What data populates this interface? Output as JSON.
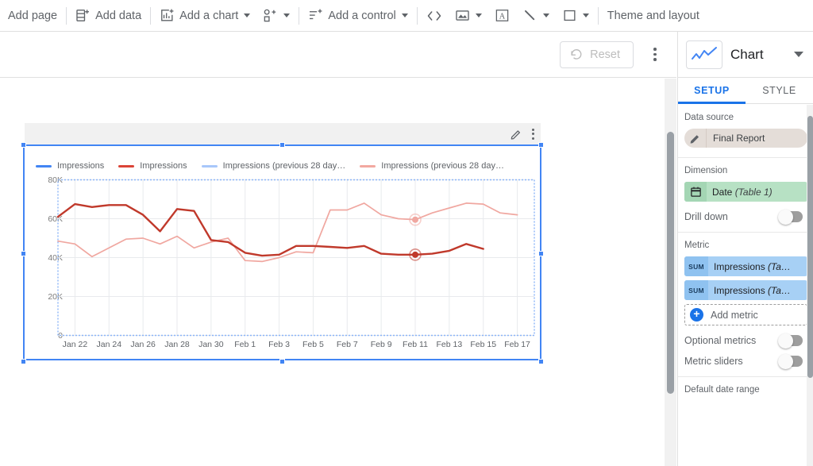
{
  "toolbar": {
    "items": [
      {
        "id": "add-page",
        "label": "Add page",
        "icon": "none",
        "caret": false
      },
      {
        "id": "add-data",
        "label": "Add data",
        "icon": "add-data",
        "caret": false
      },
      {
        "id": "add-chart",
        "label": "Add a chart",
        "icon": "add-chart",
        "caret": true
      },
      {
        "id": "add-shape",
        "label": "",
        "icon": "add-shapes",
        "caret": true
      },
      {
        "id": "add-control",
        "label": "Add a control",
        "icon": "add-control",
        "caret": true
      },
      {
        "id": "embed-code",
        "label": "",
        "icon": "code",
        "caret": false
      },
      {
        "id": "image",
        "label": "",
        "icon": "image",
        "caret": true
      },
      {
        "id": "text",
        "label": "",
        "icon": "text-box",
        "caret": false
      },
      {
        "id": "line",
        "label": "",
        "icon": "line",
        "caret": true
      },
      {
        "id": "rectangle",
        "label": "",
        "icon": "rectangle",
        "caret": true
      },
      {
        "id": "theme",
        "label": "Theme and layout",
        "icon": "none",
        "caret": false
      }
    ]
  },
  "secondbar": {
    "reset_label": "Reset",
    "reset_icon": "undo-icon",
    "more_icon": "more-vert-icon"
  },
  "chart_widget": {
    "edit_icon": "pencil-icon",
    "more_icon": "more-vert-icon",
    "selected": true
  },
  "chart_data": {
    "type": "line",
    "title": "",
    "xlabel": "",
    "ylabel": "",
    "ylim": [
      0,
      80000
    ],
    "ytick_labels": [
      "0",
      "20K",
      "40K",
      "60K",
      "80K"
    ],
    "yticks": [
      0,
      20000,
      40000,
      60000,
      80000
    ],
    "grid": true,
    "legend_position": "top",
    "x": [
      "Jan 21",
      "Jan 22",
      "Jan 23",
      "Jan 24",
      "Jan 25",
      "Jan 26",
      "Jan 27",
      "Jan 28",
      "Jan 29",
      "Jan 30",
      "Jan 31",
      "Feb 1",
      "Feb 2",
      "Feb 3",
      "Feb 4",
      "Feb 5",
      "Feb 6",
      "Feb 7",
      "Feb 8",
      "Feb 9",
      "Feb 10",
      "Feb 11",
      "Feb 12",
      "Feb 13",
      "Feb 14",
      "Feb 15",
      "Feb 16",
      "Feb 17",
      "Feb 18"
    ],
    "xtick_labels": [
      "Jan 22",
      "Jan 24",
      "Jan 26",
      "Jan 28",
      "Jan 30",
      "Feb 1",
      "Feb 3",
      "Feb 5",
      "Feb 7",
      "Feb 9",
      "Feb 11",
      "Feb 13",
      "Feb 15",
      "Feb 17"
    ],
    "series": [
      {
        "name": "Impressions",
        "color": "#c0392b",
        "legend_color": "#4285f4",
        "values": [
          61000,
          67500,
          66000,
          67000,
          67000,
          62000,
          53500,
          65000,
          64000,
          49000,
          48000,
          42500,
          41000,
          41500,
          46000,
          46000,
          45500,
          45000,
          46000,
          42000,
          41500,
          41500,
          42000,
          43500,
          47000,
          44500,
          null,
          null,
          null
        ]
      },
      {
        "name": "Impressions (previous 28 day...",
        "color": "#f0a7a0",
        "legend_color": "#a8c7fa",
        "values": [
          48500,
          47000,
          40500,
          45000,
          49500,
          50000,
          47000,
          51000,
          45000,
          48000,
          50000,
          38500,
          38000,
          40000,
          43000,
          42500,
          64500,
          64500,
          68000,
          62000,
          60000,
          59500,
          63000,
          65500,
          68000,
          67500,
          63000,
          62000,
          null
        ]
      }
    ],
    "legend": [
      {
        "label": "Impressions",
        "color": "#4285f4"
      },
      {
        "label": "Impressions",
        "color": "#db4437"
      },
      {
        "label": "Impressions (previous 28 day…",
        "color": "#a8c7fa"
      },
      {
        "label": "Impressions (previous 28 day…",
        "color": "#f2a8a0"
      }
    ],
    "highlighted_points": [
      {
        "series": "Impressions",
        "x": "Feb 11",
        "y": 41500,
        "color": "#c0392b"
      },
      {
        "series": "Impressions (previous 28 day…",
        "x": "Feb 11",
        "y": 59500,
        "color": "#f0a7a0"
      }
    ]
  },
  "rightpanel": {
    "header": {
      "title": "Chart",
      "thumb_icon": "line-chart-icon",
      "chevron_icon": "chevron-down-icon"
    },
    "tabs": [
      {
        "id": "setup",
        "label": "SETUP",
        "active": true
      },
      {
        "id": "style",
        "label": "STYLE",
        "active": false
      }
    ],
    "data_source": {
      "label": "Data source",
      "value": "Final Report",
      "icon": "pencil-icon"
    },
    "dimension": {
      "label": "Dimension",
      "chip_name": "Date",
      "chip_table": "(Table 1)",
      "icon": "calendar-icon",
      "drill_down_label": "Drill down",
      "drill_down_on": false
    },
    "metric": {
      "label": "Metric",
      "chips": [
        {
          "agg": "SUM",
          "name": "Impressions ",
          "table": "(Ta…"
        },
        {
          "agg": "SUM",
          "name": "Impressions ",
          "table": "(Ta…"
        }
      ],
      "add_label": "Add metric",
      "add_icon": "plus-circle-icon",
      "optional_metrics_label": "Optional metrics",
      "optional_metrics_on": false,
      "metric_sliders_label": "Metric sliders",
      "metric_sliders_on": false
    },
    "date_range": {
      "label": "Default date range"
    }
  },
  "colors": {
    "accent_blue": "#1a73e8",
    "selection_blue": "#4285f4",
    "metric_chip": "#a7d0f5",
    "dimension_chip": "#b7e1c4",
    "datasource_chip": "#e4ddd8"
  }
}
